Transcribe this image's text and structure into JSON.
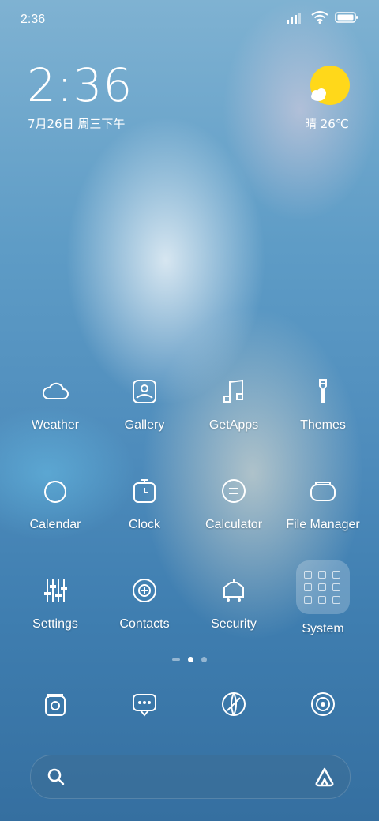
{
  "status_bar": {
    "time": "2:36"
  },
  "clock_widget": {
    "time": "2:36",
    "date": "7月26日 周三下午"
  },
  "weather_widget": {
    "text": "晴 26℃",
    "icon": "sunny-cloud-icon"
  },
  "apps": [
    {
      "label": "Weather",
      "icon": "cloud-icon"
    },
    {
      "label": "Gallery",
      "icon": "gallery-icon"
    },
    {
      "label": "GetApps",
      "icon": "music-note-icon"
    },
    {
      "label": "Themes",
      "icon": "brush-icon"
    },
    {
      "label": "Calendar",
      "icon": "calendar-icon"
    },
    {
      "label": "Clock",
      "icon": "timer-icon"
    },
    {
      "label": "Calculator",
      "icon": "calculator-icon"
    },
    {
      "label": "File Manager",
      "icon": "folder-icon"
    },
    {
      "label": "Settings",
      "icon": "sliders-icon"
    },
    {
      "label": "Contacts",
      "icon": "contacts-icon"
    },
    {
      "label": "Security",
      "icon": "shield-icon"
    },
    {
      "label": "System",
      "icon": "folder-grid-icon"
    }
  ],
  "page_indicator": {
    "pages": 2,
    "active": 1
  },
  "dock": [
    {
      "icon": "phone-icon"
    },
    {
      "icon": "messages-icon"
    },
    {
      "icon": "browser-icon"
    },
    {
      "icon": "camera-icon"
    }
  ],
  "search_bar": {
    "left_icon": "search-icon",
    "right_icon": "assistant-icon"
  }
}
